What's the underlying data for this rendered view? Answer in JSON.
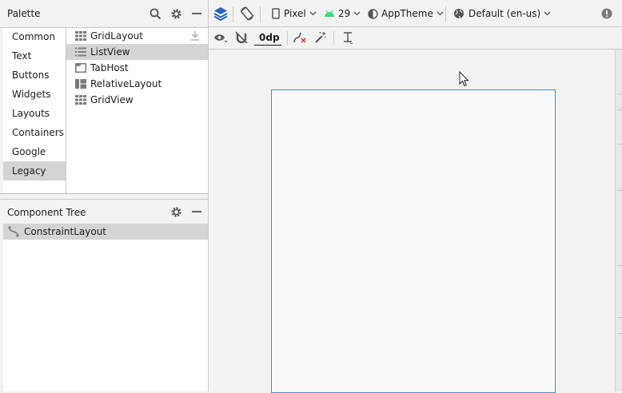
{
  "palette": {
    "title": "Palette",
    "categories": [
      "Common",
      "Text",
      "Buttons",
      "Widgets",
      "Layouts",
      "Containers",
      "Google",
      "Legacy"
    ],
    "selected_category": "Legacy",
    "items": [
      "GridLayout",
      "ListView",
      "TabHost",
      "RelativeLayout",
      "GridView"
    ],
    "selected_item": "ListView"
  },
  "component_tree": {
    "title": "Component Tree",
    "root": "ConstraintLayout"
  },
  "toolbar": {
    "device": "Pixel",
    "api_level": "29",
    "theme": "AppTheme",
    "locale": "Default (en-us)",
    "margin": "0dp"
  },
  "colors": {
    "accent": "#2962c6",
    "android_green": "#3ddc84",
    "canvas_border": "#3d8fd1",
    "selection": "#d4d4d4"
  }
}
